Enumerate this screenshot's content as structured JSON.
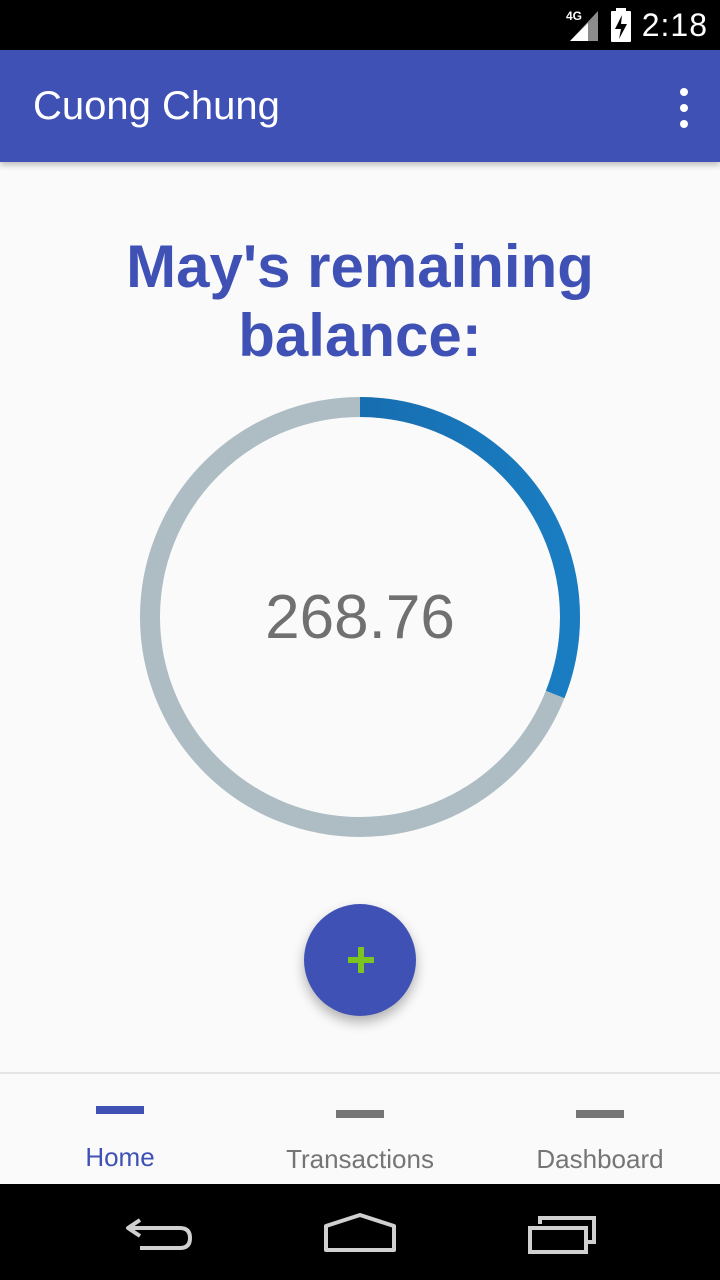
{
  "status_bar": {
    "network": "4G",
    "time": "2:18"
  },
  "app_bar": {
    "title": "Cuong Chung",
    "menu_icon": "more-vert-icon"
  },
  "main": {
    "heading": "May's remaining balance:",
    "balance": "268.76",
    "remaining_fraction": 0.31,
    "colors": {
      "ring_track": "#aebcc4",
      "ring_progress_start": "#135f9e",
      "ring_progress_end": "#1a7dc2"
    }
  },
  "fab": {
    "icon": "plus-icon",
    "icon_color": "#7cc41f"
  },
  "bottom_nav": {
    "items": [
      {
        "label": "Home",
        "active": true
      },
      {
        "label": "Transactions",
        "active": false
      },
      {
        "label": "Dashboard",
        "active": false
      }
    ]
  },
  "system_nav": {
    "back": "back-icon",
    "home": "home-icon",
    "recents": "recents-icon"
  },
  "colors": {
    "primary": "#3f51b5",
    "inactive": "#757575"
  }
}
